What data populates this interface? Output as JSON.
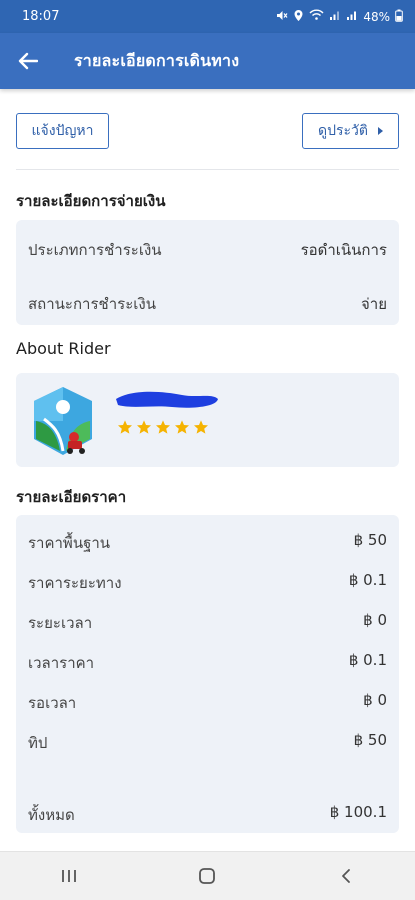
{
  "status_bar": {
    "time": "18:07",
    "battery": "48%",
    "icons": [
      "mute-icon",
      "location-icon",
      "wifi-icon",
      "signal-icon",
      "signal-icon",
      "battery-icon"
    ]
  },
  "app_bar": {
    "title": "รายละเอียดการเดินทาง",
    "back_icon": "arrow-left-icon"
  },
  "actions": {
    "report_label": "แจ้งปัญหา",
    "history_label": "ดูประวัติ"
  },
  "payment": {
    "title": "รายละเอียดการจ่ายเงิน",
    "rows": [
      {
        "label": "ประเภทการชำระเงิน",
        "value": "รอดำเนินการ"
      },
      {
        "label": "สถานะการชำระเงิน",
        "value": "จ่าย"
      }
    ]
  },
  "rider": {
    "title": "About Rider",
    "rating": 5,
    "max_rating": 5
  },
  "price": {
    "title": "รายละเอียดราคา",
    "rows": [
      {
        "label": "ราคาพื้นฐาน",
        "value": "฿ 50"
      },
      {
        "label": "ราคาระยะทาง",
        "value": "฿ 0.1"
      },
      {
        "label": "ระยะเวลา",
        "value": "฿ 0"
      },
      {
        "label": "เวลาราคา",
        "value": "฿ 0.1"
      },
      {
        "label": "รอเวลา",
        "value": "฿ 0"
      },
      {
        "label": "ทิป",
        "value": "฿ 50"
      }
    ],
    "total_label": "ทั้งหมด",
    "total_value": "฿ 100.1"
  },
  "colors": {
    "primary": "#3a6fbf",
    "card_bg": "#eef2f8",
    "star": "#f5b301"
  }
}
